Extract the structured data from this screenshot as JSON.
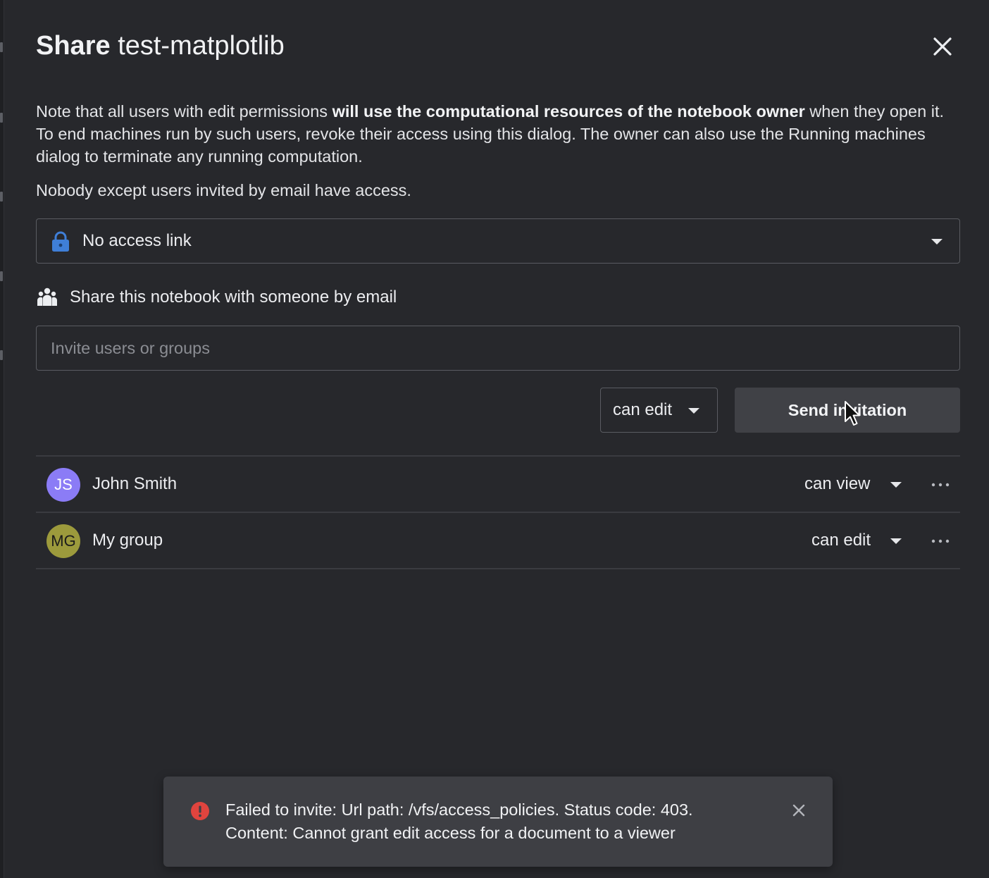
{
  "dialog": {
    "title_bold": "Share",
    "title_name": "test-matplotlib"
  },
  "note": {
    "before": "Note that all users with edit permissions ",
    "bold": "will use the computational resources of the notebook owner",
    "after": " when they open it. To end machines run by such users, revoke their access using this dialog. The owner can also use the Running machines dialog to terminate any running computation."
  },
  "access": {
    "summary": "Nobody except users invited by email have access.",
    "link_option": "No access link"
  },
  "share_email": {
    "heading": "Share this notebook with someone by email",
    "placeholder": "Invite users or groups",
    "value": "",
    "permission": "can edit",
    "send_label": "Send invitation"
  },
  "members": [
    {
      "initials": "JS",
      "name": "John Smith",
      "role": "can view",
      "avatar_color": "#8b7cf6",
      "initials_color": "#ffffff"
    },
    {
      "initials": "MG",
      "name": "My group",
      "role": "can edit",
      "avatar_color": "#9c9a3c",
      "initials_color": "#1b1b1b"
    }
  ],
  "toast": {
    "line1": "Failed to invite: Url path: /vfs/access_policies. Status code: 403.",
    "line2": "Content: Cannot grant edit access for a document to a viewer",
    "status_color": "#e0443e"
  },
  "colors": {
    "background": "#27282c",
    "lock_icon": "#3f7fd8",
    "button": "#404146",
    "toast": "#3e3f44"
  },
  "icons": {
    "close": "close-icon",
    "lock": "lock-icon",
    "people": "people-icon",
    "caret": "caret-down-icon",
    "more": "more-horizontal-icon",
    "error": "error-icon",
    "toast_close": "close-icon"
  }
}
